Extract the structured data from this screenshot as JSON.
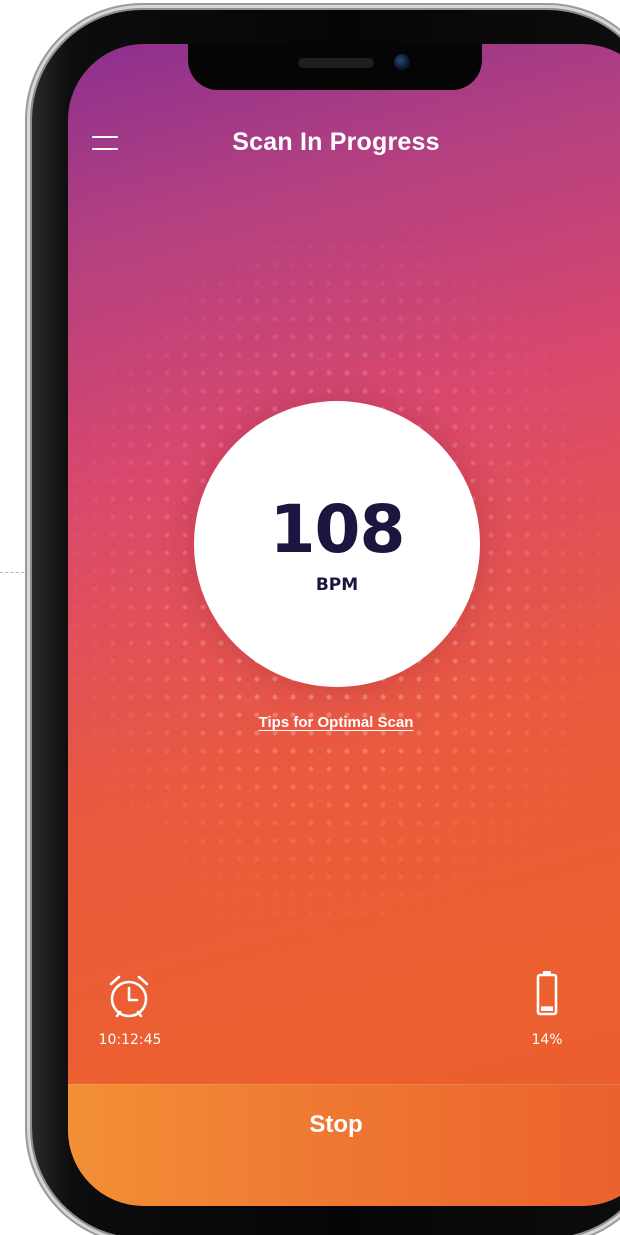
{
  "header": {
    "title": "Scan In Progress",
    "menu_icon": "hamburger-menu-icon"
  },
  "reading": {
    "value": "108",
    "unit": "BPM"
  },
  "tips_link": "Tips for Optimal Scan",
  "status": {
    "timer_icon": "alarm-clock-icon",
    "timer_value": "10:12:45",
    "battery_icon": "battery-icon",
    "battery_value": "14%",
    "battery_level": 0.14
  },
  "actions": {
    "stop_label": "Stop"
  },
  "colors": {
    "gradient_top": "#8c2f8f",
    "gradient_bottom": "#ea5b2a",
    "bpm_text": "#1b1640",
    "stop_bar_left": "#f29035",
    "stop_bar_right": "#ea5f2c"
  }
}
